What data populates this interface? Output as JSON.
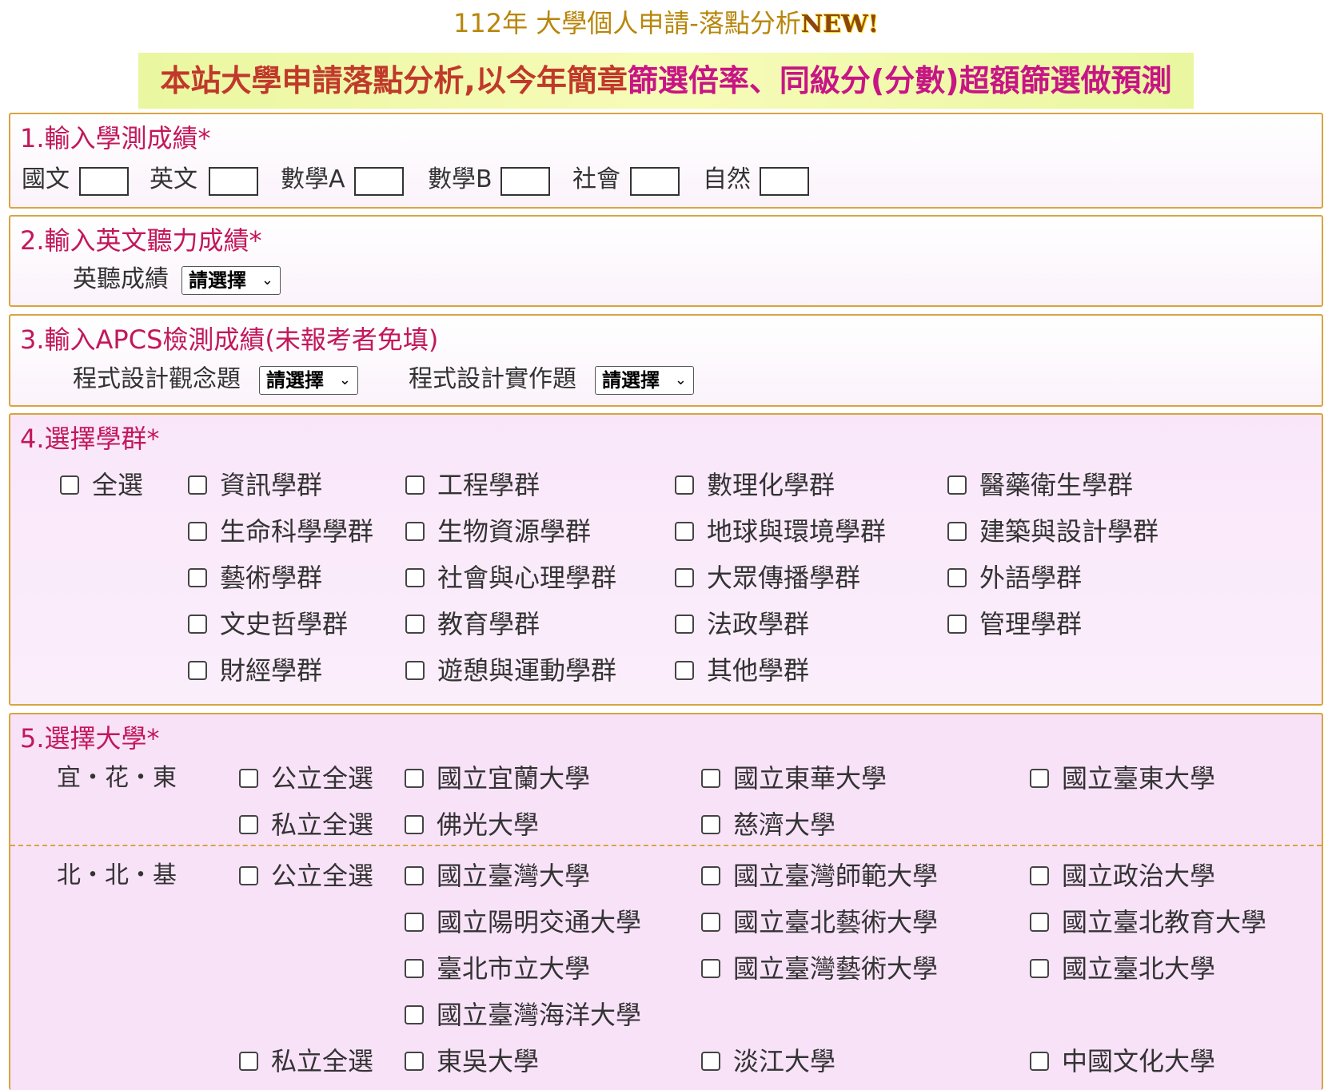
{
  "header": {
    "title": "112年 大學個人申請-落點分析",
    "new_badge": "NEW!"
  },
  "banner": {
    "text_part1": "本站大學申請落點分析,以今年簡章",
    "text_part2": "篩選倍率、同級分(分數)超額篩選做預測"
  },
  "section1": {
    "title": "1.輸入學測成績*",
    "subjects": [
      "國文",
      "英文",
      "數學A",
      "數學B",
      "社會",
      "自然"
    ]
  },
  "section2": {
    "title": "2.輸入英文聽力成績*",
    "label": "英聽成績",
    "select_value": "請選擇"
  },
  "section3": {
    "title": "3.輸入APCS檢測成績(未報考者免填)",
    "concept_label": "程式設計觀念題",
    "concept_value": "請選擇",
    "practice_label": "程式設計實作題",
    "practice_value": "請選擇"
  },
  "section4": {
    "title": "4.選擇學群*",
    "select_all": "全選",
    "groups": [
      [
        "資訊學群",
        "工程學群",
        "數理化學群",
        "醫藥衛生學群"
      ],
      [
        "生命科學學群",
        "生物資源學群",
        "地球與環境學群",
        "建築與設計學群"
      ],
      [
        "藝術學群",
        "社會與心理學群",
        "大眾傳播學群",
        "外語學群"
      ],
      [
        "文史哲學群",
        "教育學群",
        "法政學群",
        "管理學群"
      ],
      [
        "財經學群",
        "遊憩與運動學群",
        "其他學群"
      ]
    ]
  },
  "section5": {
    "title": "5.選擇大學*",
    "regions": [
      {
        "name": "宜・花・東",
        "public_all": "公立全選",
        "public": [
          "國立宜蘭大學",
          "國立東華大學",
          "國立臺東大學"
        ],
        "private_all": "私立全選",
        "private": [
          "佛光大學",
          "慈濟大學"
        ]
      },
      {
        "name": "北・北・基",
        "public_all": "公立全選",
        "public": [
          "國立臺灣大學",
          "國立臺灣師範大學",
          "國立政治大學",
          "國立陽明交通大學",
          "國立臺北藝術大學",
          "國立臺北教育大學",
          "臺北市立大學",
          "國立臺灣藝術大學",
          "國立臺北大學",
          "國立臺灣海洋大學"
        ],
        "private_all": "私立全選",
        "private": [
          "東吳大學",
          "淡江大學",
          "中國文化大學"
        ]
      }
    ]
  }
}
